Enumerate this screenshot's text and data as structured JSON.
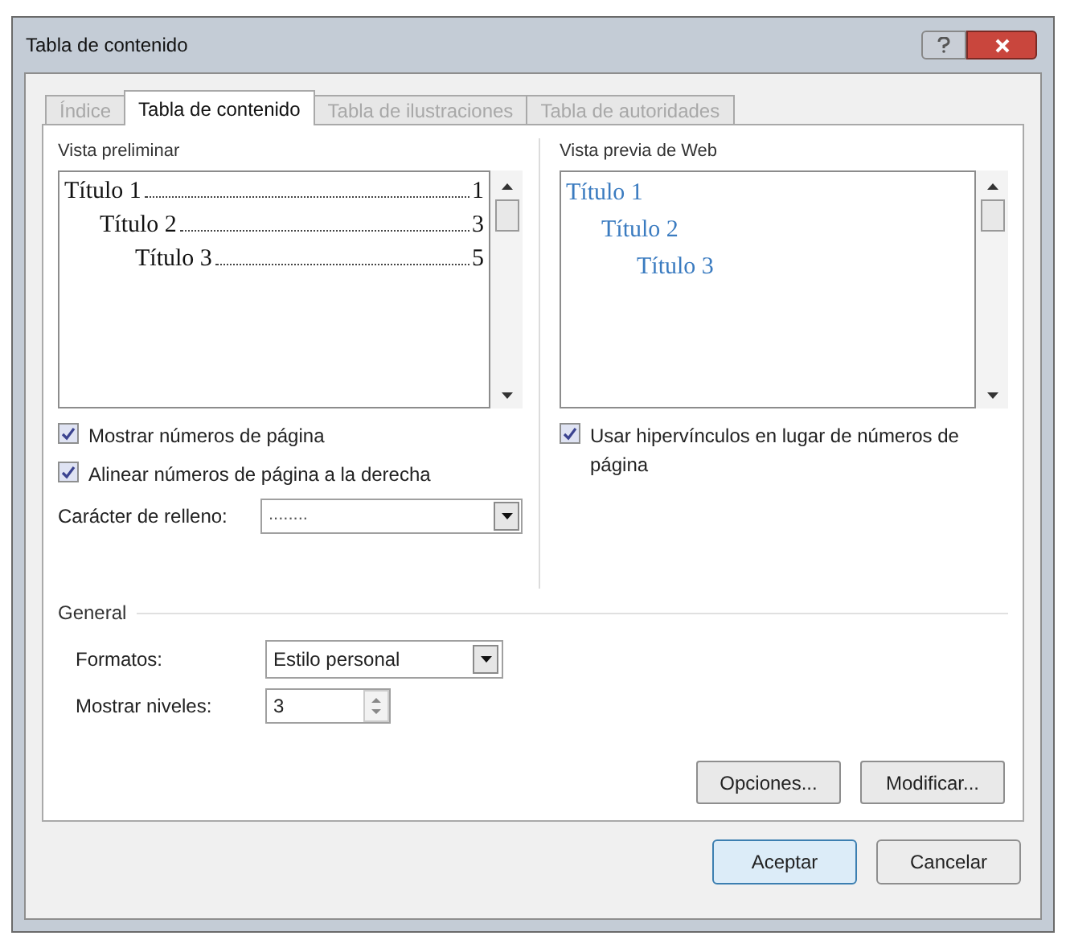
{
  "window": {
    "title": "Tabla de contenido"
  },
  "tabs": [
    {
      "label": "Índice",
      "selected": false,
      "disabled": true
    },
    {
      "label": "Tabla de contenido",
      "selected": true,
      "disabled": false
    },
    {
      "label": "Tabla de ilustraciones",
      "selected": false,
      "disabled": true
    },
    {
      "label": "Tabla de autoridades",
      "selected": false,
      "disabled": true
    }
  ],
  "print_preview": {
    "label": "Vista preliminar",
    "entries": [
      {
        "title": "Título 1",
        "page": "1",
        "children": [
          {
            "title": "Título 2",
            "page": "3",
            "children": [
              {
                "title": "Título 3",
                "page": "5"
              }
            ]
          }
        ]
      }
    ]
  },
  "print_options": [
    {
      "label": "Mostrar números de página",
      "checked": true
    },
    {
      "label": "Alinear números de página a la derecha",
      "checked": true
    }
  ],
  "leader": {
    "label": "Carácter de relleno:",
    "value": "........"
  },
  "web_preview": {
    "label": "Vista previa de Web",
    "entries": [
      {
        "title": "Título 1",
        "children": [
          {
            "title": "Título 2",
            "children": [
              {
                "title": "Título 3"
              }
            ]
          }
        ]
      }
    ]
  },
  "web_options": [
    {
      "label": "Usar hipervínculos en lugar de números de página",
      "checked": true
    }
  ],
  "general": {
    "label": "General",
    "formats": {
      "label": "Formatos:",
      "value": "Estilo personal"
    },
    "levels": {
      "label": "Mostrar niveles:",
      "value": "3"
    }
  },
  "panel_buttons": [
    "Opciones...",
    "Modificar..."
  ],
  "dialog_buttons": [
    {
      "label": "Aceptar",
      "default": true
    },
    {
      "label": "Cancelar",
      "default": false
    }
  ]
}
